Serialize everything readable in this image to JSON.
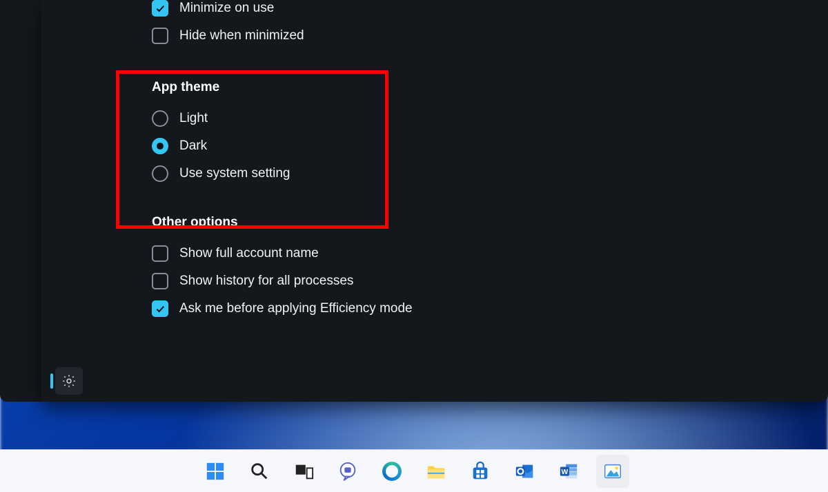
{
  "window_behavior": {
    "minimize_on_use": {
      "label": "Minimize on use",
      "checked": true
    },
    "hide_when_minimized": {
      "label": "Hide when minimized",
      "checked": false
    }
  },
  "app_theme": {
    "heading": "App theme",
    "options": {
      "light": {
        "label": "Light",
        "selected": false
      },
      "dark": {
        "label": "Dark",
        "selected": true
      },
      "system": {
        "label": "Use system setting",
        "selected": false
      }
    }
  },
  "other_options": {
    "heading": "Other options",
    "show_full_account_name": {
      "label": "Show full account name",
      "checked": false
    },
    "show_history_all_processes": {
      "label": "Show history for all processes",
      "checked": false
    },
    "ask_efficiency_mode": {
      "label": "Ask me before applying Efficiency mode",
      "checked": true
    }
  },
  "colors": {
    "accent": "#35c5f3",
    "highlight": "#ff0000",
    "panel_bg": "#14171c"
  },
  "taskbar": {
    "icons": [
      "start",
      "search",
      "task-view",
      "chat",
      "edge",
      "file-explorer",
      "microsoft-store",
      "outlook",
      "word",
      "photos"
    ]
  }
}
